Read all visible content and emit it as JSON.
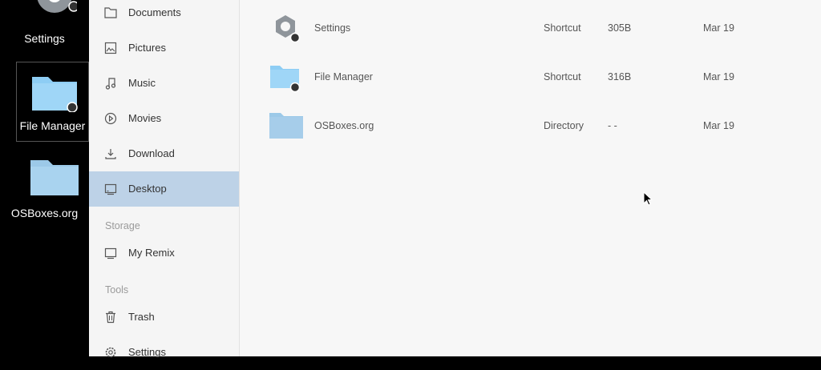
{
  "desktop": {
    "icons": [
      {
        "label": "Settings",
        "icon": "gear-icon"
      },
      {
        "label": "File Manager",
        "icon": "folder-icon"
      },
      {
        "label": "OSBoxes.org",
        "icon": "folder-icon"
      }
    ]
  },
  "sidebar": {
    "items": [
      {
        "label": "Documents",
        "icon": "document-icon"
      },
      {
        "label": "Pictures",
        "icon": "picture-icon"
      },
      {
        "label": "Music",
        "icon": "music-icon"
      },
      {
        "label": "Movies",
        "icon": "play-icon"
      },
      {
        "label": "Download",
        "icon": "download-icon"
      },
      {
        "label": "Desktop",
        "icon": "monitor-icon",
        "active": true
      }
    ],
    "storage_heading": "Storage",
    "storage_items": [
      {
        "label": "My Remix",
        "icon": "monitor-icon"
      }
    ],
    "tools_heading": "Tools",
    "tools_items": [
      {
        "label": "Trash",
        "icon": "trash-icon"
      },
      {
        "label": "Settings",
        "icon": "gear-icon"
      }
    ]
  },
  "files": [
    {
      "name": "Settings",
      "type": "Shortcut",
      "size": "305B",
      "date": "Mar 19",
      "icon": "gear-icon"
    },
    {
      "name": "File Manager",
      "type": "Shortcut",
      "size": "316B",
      "date": "Mar 19",
      "icon": "folder-icon"
    },
    {
      "name": "OSBoxes.org",
      "type": "Directory",
      "size": "- -",
      "date": "Mar 19",
      "icon": "folder-icon"
    }
  ],
  "colors": {
    "sidebar_active": "#bdd2e7",
    "folder_blue": "#a9cdea",
    "background_desktop": "#000000"
  }
}
